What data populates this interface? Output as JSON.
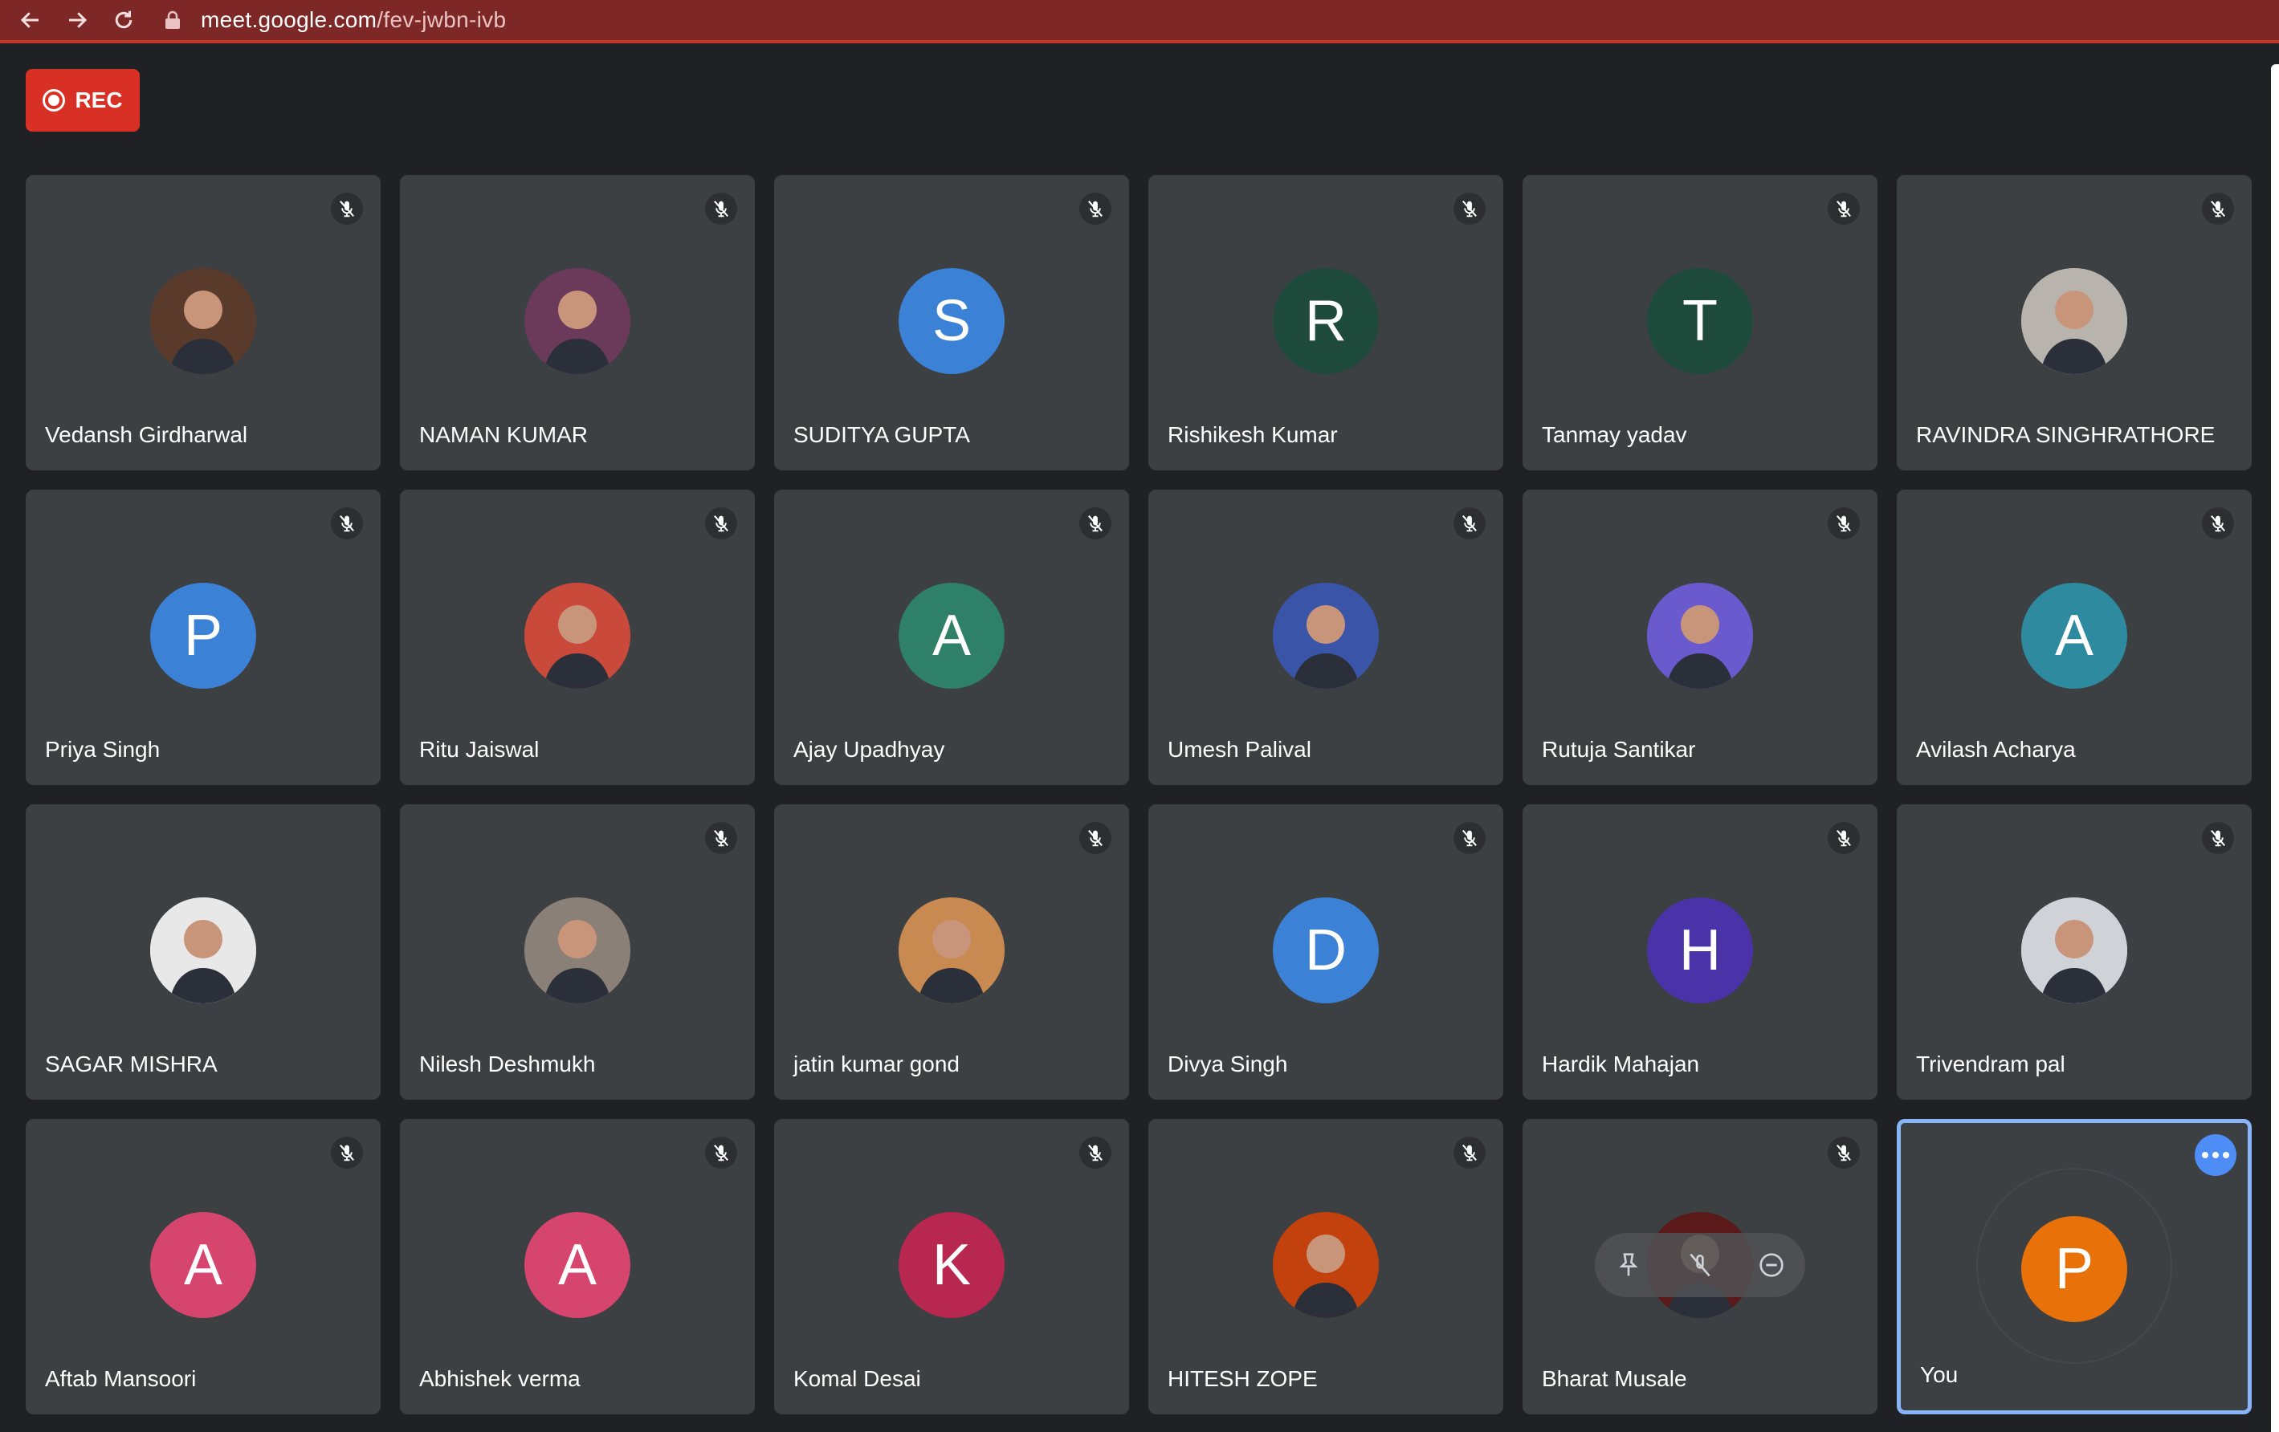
{
  "browser": {
    "url_host": "meet.google.com",
    "url_path": "/fev-jwbn-ivb"
  },
  "rec": {
    "label": "REC"
  },
  "participants": [
    {
      "name": "Vedansh Girdharwal",
      "avatar": "photo",
      "muted": true,
      "color": "#5a3a2a"
    },
    {
      "name": "NAMAN KUMAR",
      "avatar": "photo",
      "muted": true,
      "color": "#6b3a5a"
    },
    {
      "name": "SUDITYA GUPTA",
      "avatar": "letter",
      "letter": "S",
      "muted": true,
      "color": "#3b82d6"
    },
    {
      "name": "Rishikesh Kumar",
      "avatar": "letter",
      "letter": "R",
      "muted": true,
      "color": "#1e4a3c"
    },
    {
      "name": "Tanmay yadav",
      "avatar": "letter",
      "letter": "T",
      "muted": true,
      "color": "#1e4a3c"
    },
    {
      "name": "RAVINDRA SINGHRATHORE",
      "avatar": "photo",
      "muted": true,
      "color": "#b8b3ad"
    },
    {
      "name": "Priya Singh",
      "avatar": "letter",
      "letter": "P",
      "muted": true,
      "color": "#3b82d6"
    },
    {
      "name": "Ritu Jaiswal",
      "avatar": "photo",
      "muted": true,
      "color": "#c94a3a"
    },
    {
      "name": "Ajay Upadhyay",
      "avatar": "letter",
      "letter": "A",
      "muted": true,
      "color": "#2e8068"
    },
    {
      "name": "Umesh Palival",
      "avatar": "photo",
      "muted": true,
      "color": "#3a55a8"
    },
    {
      "name": "Rutuja Santikar",
      "avatar": "photo",
      "muted": true,
      "color": "#6a5acd"
    },
    {
      "name": "Avilash Acharya",
      "avatar": "letter",
      "letter": "A",
      "muted": true,
      "color": "#2e8a9e"
    },
    {
      "name": "SAGAR MISHRA",
      "avatar": "photo",
      "muted": false,
      "color": "#e8e8e8"
    },
    {
      "name": "Nilesh Deshmukh",
      "avatar": "photo",
      "muted": true,
      "color": "#8a8077"
    },
    {
      "name": "jatin kumar gond",
      "avatar": "photo",
      "muted": true,
      "color": "#c98a52"
    },
    {
      "name": "Divya Singh",
      "avatar": "letter",
      "letter": "D",
      "muted": true,
      "color": "#3b82d6"
    },
    {
      "name": "Hardik Mahajan",
      "avatar": "letter",
      "letter": "H",
      "muted": true,
      "color": "#4a33a8"
    },
    {
      "name": "Trivendram pal",
      "avatar": "photo",
      "muted": true,
      "color": "#cfd2d6"
    },
    {
      "name": "Aftab Mansoori",
      "avatar": "letter",
      "letter": "A",
      "muted": true,
      "color": "#d6456e"
    },
    {
      "name": "Abhishek verma",
      "avatar": "letter",
      "letter": "A",
      "muted": true,
      "color": "#d6456e"
    },
    {
      "name": "Komal Desai",
      "avatar": "letter",
      "letter": "K",
      "muted": true,
      "color": "#b8274f"
    },
    {
      "name": "HITESH ZOPE",
      "avatar": "photo",
      "muted": true,
      "color": "#c2410c"
    },
    {
      "name": "Bharat Musale",
      "avatar": "photo",
      "muted": true,
      "color": "#5a1a1a"
    },
    {
      "name": "You",
      "avatar": "letter",
      "letter": "P",
      "muted": false,
      "color": "#e8710a",
      "self": true
    }
  ]
}
